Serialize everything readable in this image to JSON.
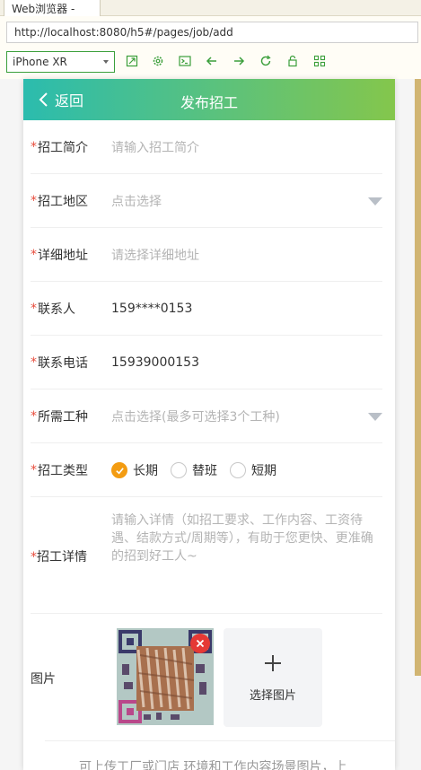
{
  "browser": {
    "tab_title": "Web浏览器 -",
    "url": "http://localhost:8080/h5#/pages/job/add",
    "device": "iPhone XR",
    "toolbar_icons": [
      "rotate-icon",
      "settings-icon",
      "console-icon",
      "back-icon",
      "forward-icon",
      "refresh-icon",
      "lock-icon",
      "qrcode-icon"
    ]
  },
  "nav": {
    "back_label": "返回",
    "title": "发布招工"
  },
  "form": {
    "intro": {
      "label": "招工简介",
      "placeholder": "请输入招工简介"
    },
    "region": {
      "label": "招工地区",
      "placeholder": "点击选择"
    },
    "address": {
      "label": "详细地址",
      "placeholder": "请选择详细地址"
    },
    "contact": {
      "label": "联系人",
      "value": "159****0153"
    },
    "phone": {
      "label": "联系电话",
      "value": "15939000153"
    },
    "trades": {
      "label": "所需工种",
      "placeholder": "点击选择(最多可选择3个工种)"
    },
    "type": {
      "label": "招工类型",
      "options": [
        "长期",
        "替班",
        "短期"
      ],
      "selected": "长期"
    },
    "detail": {
      "label": "招工详情",
      "placeholder": "请输入详情（如招工要求、工作内容、工资待遇、结款方式/周期等），有助于您更快、更准确的招到好工人~"
    },
    "images": {
      "label": "图片",
      "add_label": "选择图片"
    },
    "hint": "可上传工厂或门店 环境和工作内容场景图片，上"
  },
  "colors": {
    "nav_gradient_start": "#2bbcae",
    "nav_gradient_end": "#84c64c",
    "required_star": "#e74c3c",
    "radio_checked": "#f39c12",
    "placeholder": "#b4b4b4"
  }
}
